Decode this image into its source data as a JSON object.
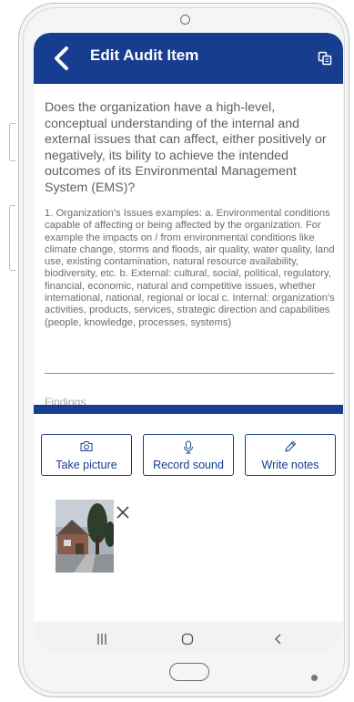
{
  "appbar": {
    "title": "Edit Audit Item",
    "back_icon": "back-arrow-icon",
    "copy_icon": "copy-icon",
    "background_color": "#163d8f"
  },
  "question": "Does the organization have a high-level, conceptual understanding of the internal and external issues that can affect, either positively or negatively, its bility to achieve the intended outcomes of its Environmental Management System (EMS)?",
  "description": "1. Organization's Issues examples: a. Environmental conditions capable of affecting or being affected by the organization. For example the impacts on / from environmental conditions like climate change, storms and floods, air quality, water quality, land use, existing contamination, natural resource availability, biodiversity, etc. b. External: cultural, social, political, regulatory, financial, economic, natural and competitive issues, whether international, national, regional or local c. Internal: organization's activities, products, services, strategic direction and capabilities (people, knowledge, processes, systems)",
  "findings": {
    "placeholder": "Findings",
    "value": ""
  },
  "actions": [
    {
      "label": "Take picture",
      "icon": "camera-icon"
    },
    {
      "label": "Record sound",
      "icon": "microphone-icon"
    },
    {
      "label": "Write notes",
      "icon": "pencil-icon"
    }
  ],
  "attachment": {
    "type": "photo",
    "remove_icon": "close-icon"
  },
  "system_nav": {
    "recents_icon": "recents-icon",
    "home_icon": "home-icon",
    "back_icon": "back-icon"
  }
}
